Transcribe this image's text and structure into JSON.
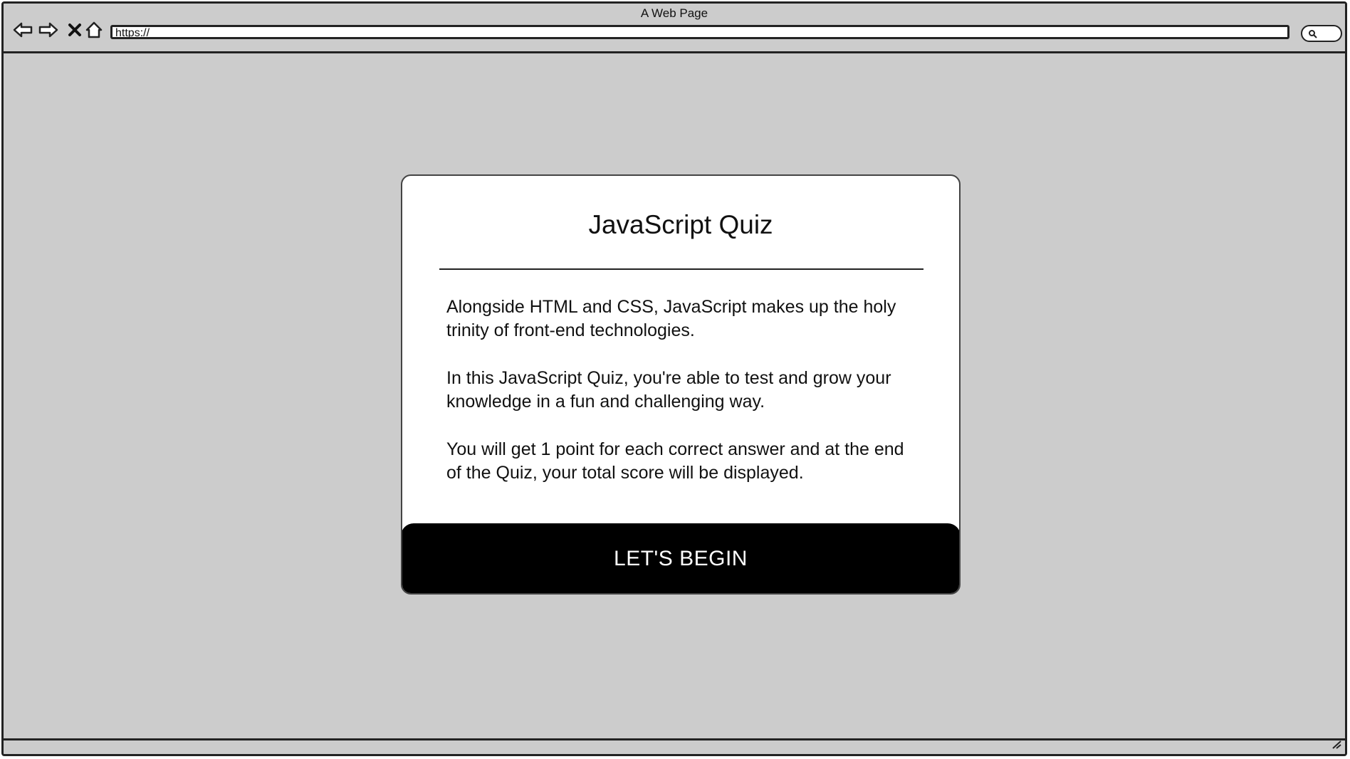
{
  "window": {
    "title": "A Web Page",
    "url": "https://"
  },
  "toolbar": {
    "icons": [
      "back-arrow-icon",
      "forward-arrow-icon",
      "close-x-icon",
      "home-icon",
      "search-icon",
      "resize-grip-icon"
    ]
  },
  "quiz_card": {
    "title": "JavaScript Quiz",
    "paragraphs": [
      "Alongside HTML and CSS, JavaScript makes up the holy trinity of front-end technologies.",
      "In this JavaScript Quiz, you're able to test and grow your knowledge in a fun and challenging way.",
      "You will get 1 point for each correct answer and at the end of the Quiz, your total score will be displayed."
    ],
    "button_label": "LET'S BEGIN"
  },
  "colors": {
    "background": "#cccccc",
    "card": "#ffffff",
    "button": "#000000",
    "button_text": "#ffffff",
    "outline": "#222222"
  }
}
